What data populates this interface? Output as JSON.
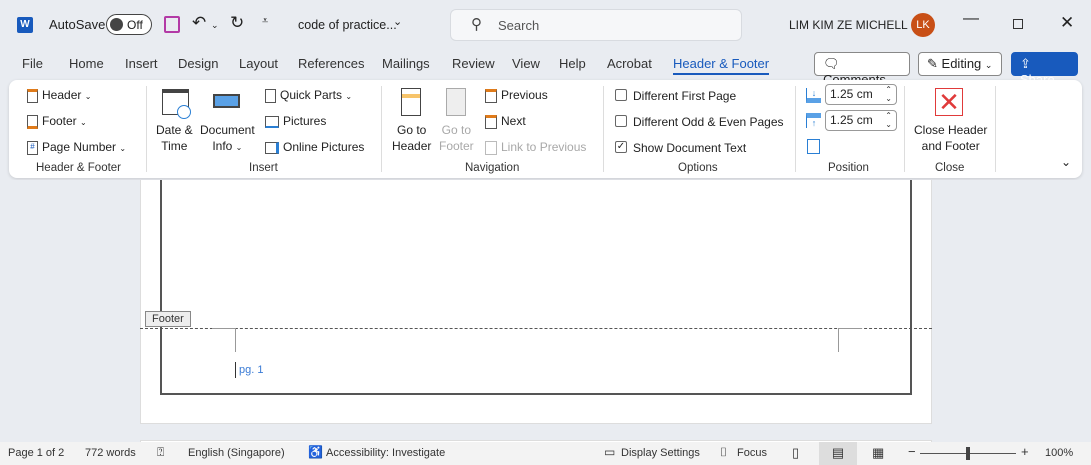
{
  "titlebar": {
    "autosave": "AutoSave",
    "toggle": "Off",
    "doc_title": "code of practice...",
    "search": "Search",
    "user": "LIM KIM ZE MICHELL",
    "avatar": "LK",
    "accent": "#185abd",
    "avatar_color": "#c84f16"
  },
  "tabs": [
    "File",
    "Home",
    "Insert",
    "Design",
    "Layout",
    "References",
    "Mailings",
    "Review",
    "View",
    "Help",
    "Acrobat",
    "Header & Footer"
  ],
  "actions": {
    "comments": "Comments",
    "editing": "Editing",
    "share": "Share"
  },
  "ribbon": {
    "header_footer": {
      "header": "Header",
      "footer": "Footer",
      "page_number": "Page Number",
      "label": "Header & Footer"
    },
    "insert": {
      "date_time_1": "Date &",
      "date_time_2": "Time",
      "doc_info_1": "Document",
      "doc_info_2": "Info",
      "quick_parts": "Quick Parts",
      "pictures": "Pictures",
      "online_pictures": "Online Pictures",
      "label": "Insert"
    },
    "navigation": {
      "goto_header_1": "Go to",
      "goto_header_2": "Header",
      "goto_footer_1": "Go to",
      "goto_footer_2": "Footer",
      "previous": "Previous",
      "next": "Next",
      "link_prev": "Link to Previous",
      "label": "Navigation"
    },
    "options": {
      "diff_first": "Different First Page",
      "diff_odd_even": "Different Odd & Even Pages",
      "show_doc_text": "Show Document Text",
      "diff_first_checked": false,
      "diff_odd_even_checked": false,
      "show_doc_text_checked": true,
      "label": "Options"
    },
    "position": {
      "header_pos": "1.25 cm",
      "footer_pos": "1.25 cm",
      "label": "Position"
    },
    "close": {
      "close_1": "Close Header",
      "close_2": "and Footer",
      "label": "Close"
    }
  },
  "document": {
    "footer_tag": "Footer",
    "page_number_text": "pg. 1"
  },
  "status": {
    "page": "Page 1 of 2",
    "words": "772 words",
    "language": "English (Singapore)",
    "accessibility": "Accessibility: Investigate",
    "display": "Display Settings",
    "focus": "Focus",
    "zoom": "100%",
    "zoom_level": 100
  }
}
